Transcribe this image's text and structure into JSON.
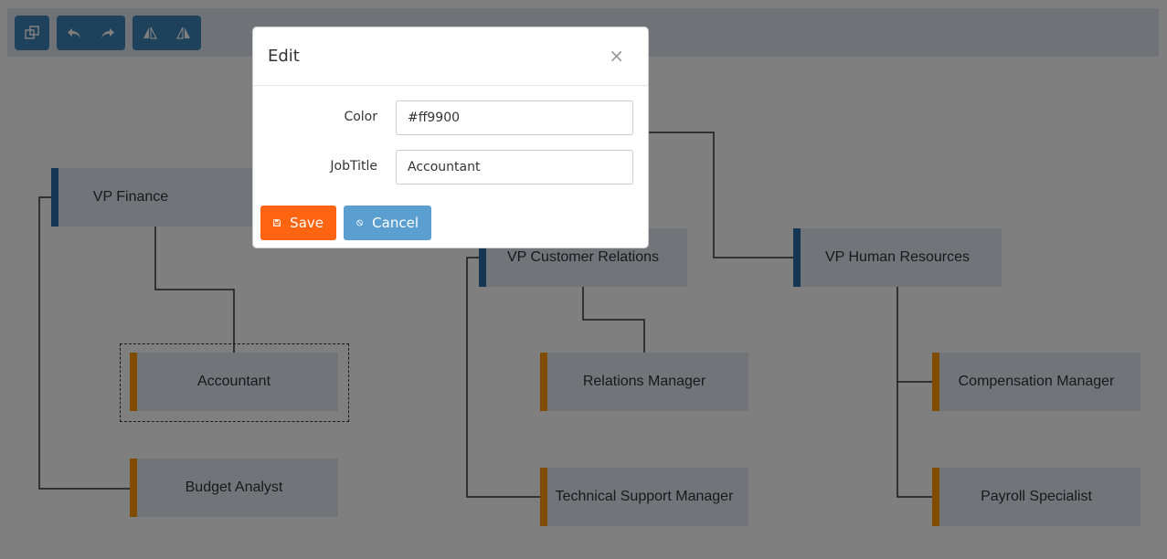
{
  "toolbar": {
    "groups": [
      {
        "items": [
          {
            "icon": "select-icon"
          }
        ]
      },
      {
        "items": [
          {
            "icon": "undo-icon"
          },
          {
            "icon": "redo-icon"
          }
        ]
      },
      {
        "items": [
          {
            "icon": "flip-horizontal-icon"
          },
          {
            "icon": "flip-vertical-icon"
          }
        ]
      }
    ]
  },
  "colors": {
    "vp_bar": "#2a6fa8",
    "staff_bar": "#ff9900",
    "node_bg": "#e3eaf2",
    "save": "#ff6410",
    "cancel": "#5a9fd0"
  },
  "nodes": {
    "vp_finance": "VP Finance",
    "accountant": "Accountant",
    "budget_analyst": "Budget Analyst",
    "vp_customer_relations": "VP Customer Relations",
    "relations_manager": "Relations Manager",
    "technical_support_manager": "Technical Support Manager",
    "vp_human_resources": "VP Human Resources",
    "compensation_manager": "Compensation Manager",
    "payroll_specialist": "Payroll Specialist"
  },
  "dialog": {
    "title": "Edit",
    "close": "×",
    "fields": {
      "color": {
        "label": "Color",
        "value": "#ff9900"
      },
      "job_title": {
        "label": "JobTitle",
        "value": "Accountant"
      }
    },
    "save_label": "Save",
    "cancel_label": "Cancel"
  }
}
